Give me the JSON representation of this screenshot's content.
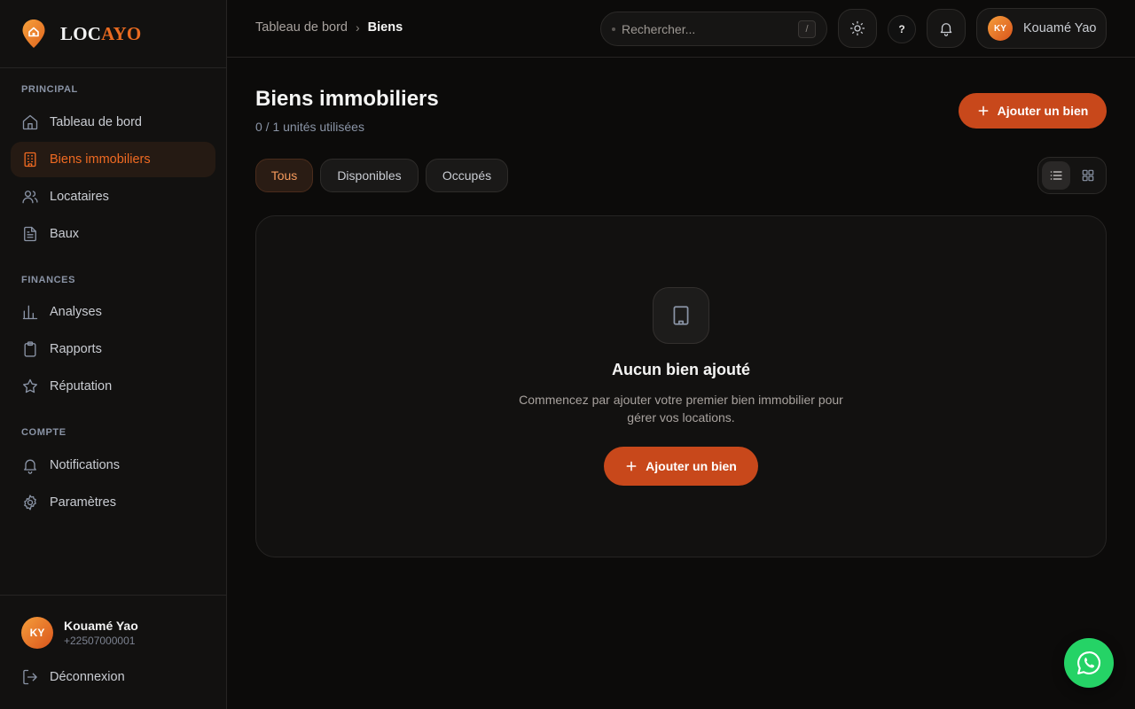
{
  "brand": {
    "part1": "LOC",
    "part2": "AYO"
  },
  "sidebar": {
    "sections": [
      "PRINCIPAL",
      "FINANCES",
      "COMPTE"
    ],
    "items": [
      {
        "label": "Tableau de bord",
        "icon": "home-icon"
      },
      {
        "label": "Biens immobiliers",
        "icon": "building-icon",
        "active": true
      },
      {
        "label": "Locataires",
        "icon": "users-icon"
      },
      {
        "label": "Baux",
        "icon": "document-icon"
      },
      {
        "label": "Analyses",
        "icon": "bar-chart-icon"
      },
      {
        "label": "Rapports",
        "icon": "clipboard-icon"
      },
      {
        "label": "Réputation",
        "icon": "star-icon"
      },
      {
        "label": "Notifications",
        "icon": "bell-icon"
      },
      {
        "label": "Paramètres",
        "icon": "gear-icon"
      }
    ],
    "user": {
      "initials": "KY",
      "name": "Kouamé Yao",
      "phone": "+22507000001"
    },
    "logout_label": "Déconnexion"
  },
  "header": {
    "breadcrumb": {
      "root": "Tableau de bord",
      "separator": "›",
      "current": "Biens"
    },
    "search": {
      "placeholder": "Rechercher...",
      "shortcut": "/"
    },
    "help_label": "?",
    "user": {
      "initials": "KY",
      "name": "Kouamé Yao"
    }
  },
  "main": {
    "title": "Biens immobiliers",
    "subtitle": "0 / 1 unités utilisées",
    "add_label": "Ajouter un bien",
    "filters": [
      "Tous",
      "Disponibles",
      "Occupés"
    ],
    "active_filter": "Tous",
    "view_mode": "list",
    "empty": {
      "title": "Aucun bien ajouté",
      "description": "Commencez par ajouter votre premier bien immobilier pour gérer vos locations.",
      "button_label": "Ajouter un bien"
    }
  },
  "colors": {
    "accent": "#c8481b",
    "accent_text": "#ef6a22",
    "whatsapp": "#25d366"
  }
}
